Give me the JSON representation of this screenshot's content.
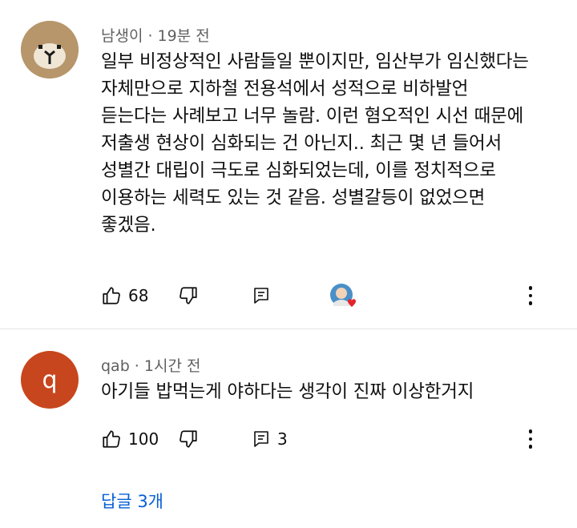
{
  "comments": [
    {
      "author": "남생이",
      "time": "19분 전",
      "meta": "남생이 · 19분 전",
      "text": "일부 비정상적인 사람들일 뿐이지만, 임산부가 임신했다는\n자체만으로 지하철 전용석에서 성적으로 비하발언\n듣는다는 사례보고 너무 놀람. 이런 혐오적인 시선 때문에\n저출생 현상이 심화되는 건 아닌지.. 최근 몇 년 들어서\n성별간 대립이 극도로 심화되었는데, 이를 정치적으로\n이용하는 세력도 있는 것 같음. 성별갈등이 없었으면\n좋겠음.",
      "likes": "68",
      "avatar_icon": "bear-face-avatar",
      "creator_heart_icon": "creator-heart-icon"
    },
    {
      "author": "qab",
      "time": "1시간 전",
      "meta": "qab · 1시간 전",
      "avatar_letter": "q",
      "avatar_color": "#c8461d",
      "text": "아기들 밥먹는게 야하다는 생각이 진짜 이상한거지",
      "likes": "100",
      "replies_count": "3"
    }
  ],
  "replies_link": "답글 3개",
  "colors": {
    "meta": "#606060",
    "link": "#065fd4",
    "divider": "#e5e5e5"
  }
}
